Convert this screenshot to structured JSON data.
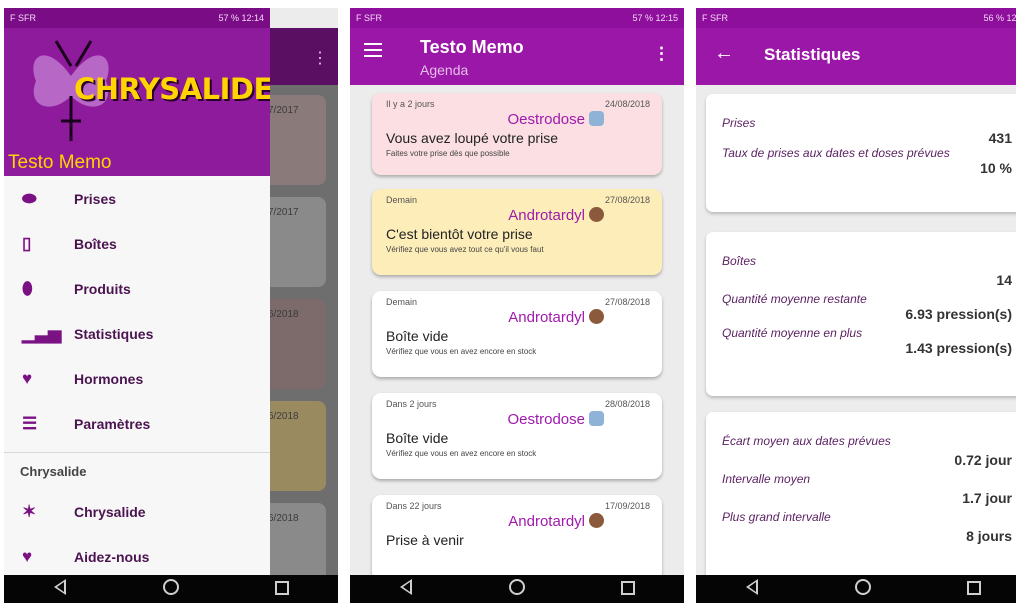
{
  "phone1": {
    "status": {
      "carrier": "F SFR",
      "right": "57 % 12:14"
    },
    "drawer": {
      "logo_text": "CHRYSALIDE",
      "title": "Testo Memo",
      "items": [
        {
          "label": "Prises",
          "icon": "lips-icon"
        },
        {
          "label": "Boîtes",
          "icon": "bottle-icon"
        },
        {
          "label": "Produits",
          "icon": "pill-icon"
        },
        {
          "label": "Statistiques",
          "icon": "chart-icon"
        },
        {
          "label": "Hormones",
          "icon": "heart-icon"
        },
        {
          "label": "Paramètres",
          "icon": "sliders-icon"
        }
      ],
      "section_title": "Chrysalide",
      "section_items": [
        {
          "label": "Chrysalide",
          "icon": "butterfly-icon"
        },
        {
          "label": "Aidez-nous",
          "icon": "heart-hand-icon"
        }
      ]
    },
    "background_dates": [
      "7/2017",
      "7/2017",
      "6/2018",
      "6/2018",
      "6/2018"
    ],
    "background_card_colors": [
      "#8a7a7a",
      "#8a8a8a",
      "#7d6a6a",
      "#9a8a60",
      "#8a8a8a"
    ]
  },
  "phone2": {
    "status": {
      "carrier": "F SFR",
      "right": "57 % 12:15"
    },
    "appbar": {
      "title": "Testo Memo",
      "subtitle": "Agenda"
    },
    "cards": [
      {
        "when": "Il y a 2 jours",
        "date": "24/08/2018",
        "product": "Oestrodose",
        "product_icon": "vial-icon",
        "title": "Vous avez loupé votre prise",
        "note": "Faites votre prise dès que possible",
        "color": "#fbdfe2"
      },
      {
        "when": "Demain",
        "date": "27/08/2018",
        "product": "Androtardyl",
        "product_icon": "bear-icon",
        "title": "C'est bientôt votre prise",
        "note": "Vérifiez que vous avez tout ce qu'il vous faut",
        "color": "#fdeeb9"
      },
      {
        "when": "Demain",
        "date": "27/08/2018",
        "product": "Androtardyl",
        "product_icon": "bear-icon",
        "title": "Boîte vide",
        "note": "Vérifiez que vous en avez encore en stock",
        "color": "#ffffff"
      },
      {
        "when": "Dans 2 jours",
        "date": "28/08/2018",
        "product": "Oestrodose",
        "product_icon": "vial-icon",
        "title": "Boîte vide",
        "note": "Vérifiez que vous en avez encore en stock",
        "color": "#ffffff"
      },
      {
        "when": "Dans 22 jours",
        "date": "17/09/2018",
        "product": "Androtardyl",
        "product_icon": "bear-icon",
        "title": "Prise à venir",
        "note": "",
        "color": "#ffffff"
      }
    ]
  },
  "phone3": {
    "status": {
      "carrier": "F SFR",
      "right": "56 % 12:1"
    },
    "appbar": {
      "title": "Statistiques"
    },
    "cards": [
      {
        "rows": [
          {
            "label": "Prises",
            "value": "431"
          },
          {
            "label": "Taux de prises aux dates et doses prévues",
            "value": "10 %"
          }
        ]
      },
      {
        "rows": [
          {
            "label": "Boîtes",
            "value": "14"
          },
          {
            "label": "Quantité moyenne restante",
            "value": "6.93 pression(s)"
          },
          {
            "label": "Quantité moyenne en plus",
            "value": "1.43 pression(s)"
          }
        ]
      },
      {
        "rows": [
          {
            "label": "Écart moyen aux dates prévues",
            "value": "0.72 jour"
          },
          {
            "label": "Intervalle moyen",
            "value": "1.7 jour"
          },
          {
            "label": "Plus grand intervalle",
            "value": "8 jours"
          }
        ]
      }
    ]
  },
  "colors": {
    "primary": "#9b17a8",
    "primary_dark": "#8e0f9b",
    "logo_yellow": "#ffd400"
  }
}
